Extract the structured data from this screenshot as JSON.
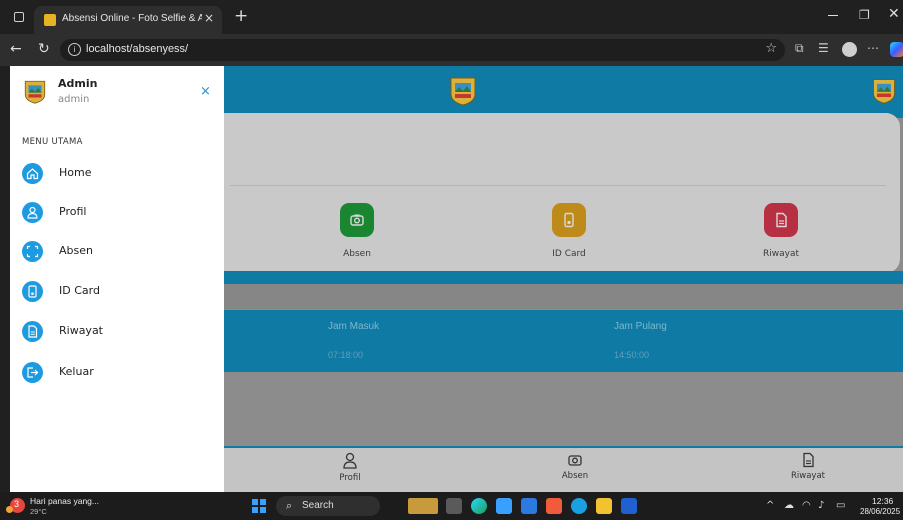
{
  "browser": {
    "tab_title": "Absensi Online - Foto Selfie & Ab",
    "tab_close": "×",
    "new_tab": "+",
    "url": "localhost/absenyess/"
  },
  "sidebar": {
    "user_name": "Admin",
    "user_role": "admin",
    "close": "×",
    "section_title": "MENU UTAMA",
    "items": [
      {
        "label": "Home",
        "icon": "home-icon"
      },
      {
        "label": "Profil",
        "icon": "user-icon"
      },
      {
        "label": "Absen",
        "icon": "scan-icon"
      },
      {
        "label": "ID Card",
        "icon": "id-card-icon"
      },
      {
        "label": "Riwayat",
        "icon": "document-icon"
      },
      {
        "label": "Keluar",
        "icon": "logout-icon"
      }
    ]
  },
  "main": {
    "menu_tiles": [
      {
        "label": "Absen",
        "color": "#1f9e3a",
        "icon": "camera-icon"
      },
      {
        "label": "ID Card",
        "color": "#e0a21f",
        "icon": "id-card-icon"
      },
      {
        "label": "Riwayat",
        "color": "#d6374f",
        "icon": "document-icon"
      }
    ],
    "jam_masuk_label": "Jam Masuk",
    "jam_masuk_value": "07:18:00",
    "jam_pulang_label": "Jam Pulang",
    "jam_pulang_value": "14:50:00"
  },
  "bottom_nav": [
    {
      "label": "Profil",
      "icon": "user-icon"
    },
    {
      "label": "Absen",
      "icon": "camera-icon"
    },
    {
      "label": "Riwayat",
      "icon": "document-icon"
    }
  ],
  "taskbar": {
    "weather_text": "Hari panas yang...",
    "weather_temp": "29°C",
    "weather_badge": "3",
    "search": "Search",
    "time": "12:36",
    "date": "28/06/2025"
  },
  "colors": {
    "primary_blue": "#1e9be0",
    "header_blue": "#0f7aa3"
  }
}
